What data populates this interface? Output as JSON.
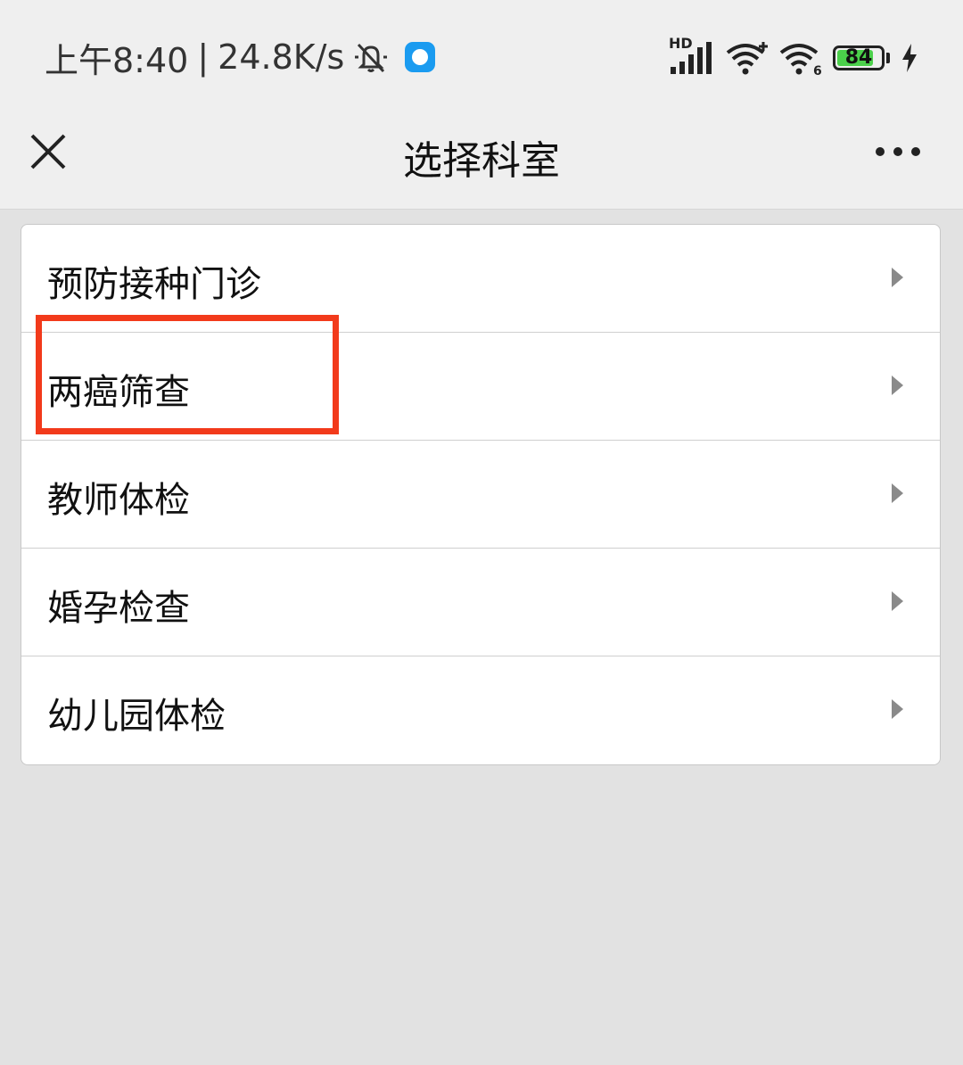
{
  "status_bar": {
    "time": "上午8:40",
    "separator": "|",
    "net_speed": "24.8K/s",
    "hd_label": "HD",
    "battery_level": "84",
    "icons": [
      "mute-icon",
      "app-badge-icon",
      "signal-icon",
      "wifi-plus-icon",
      "wifi-6-icon",
      "battery-icon",
      "charging-icon"
    ]
  },
  "title_bar": {
    "title": "选择科室",
    "icons": [
      "close-icon",
      "more-icon"
    ]
  },
  "departments": [
    {
      "label": "预防接种门诊"
    },
    {
      "label": "两癌筛查"
    },
    {
      "label": "教师体检"
    },
    {
      "label": "婚孕检查"
    },
    {
      "label": "幼儿园体检"
    }
  ],
  "colors": {
    "highlight": "#f23a1b",
    "battery_fill": "#4bd04b",
    "app_badge": "#1a9bf0",
    "background": "#e2e2e2"
  }
}
